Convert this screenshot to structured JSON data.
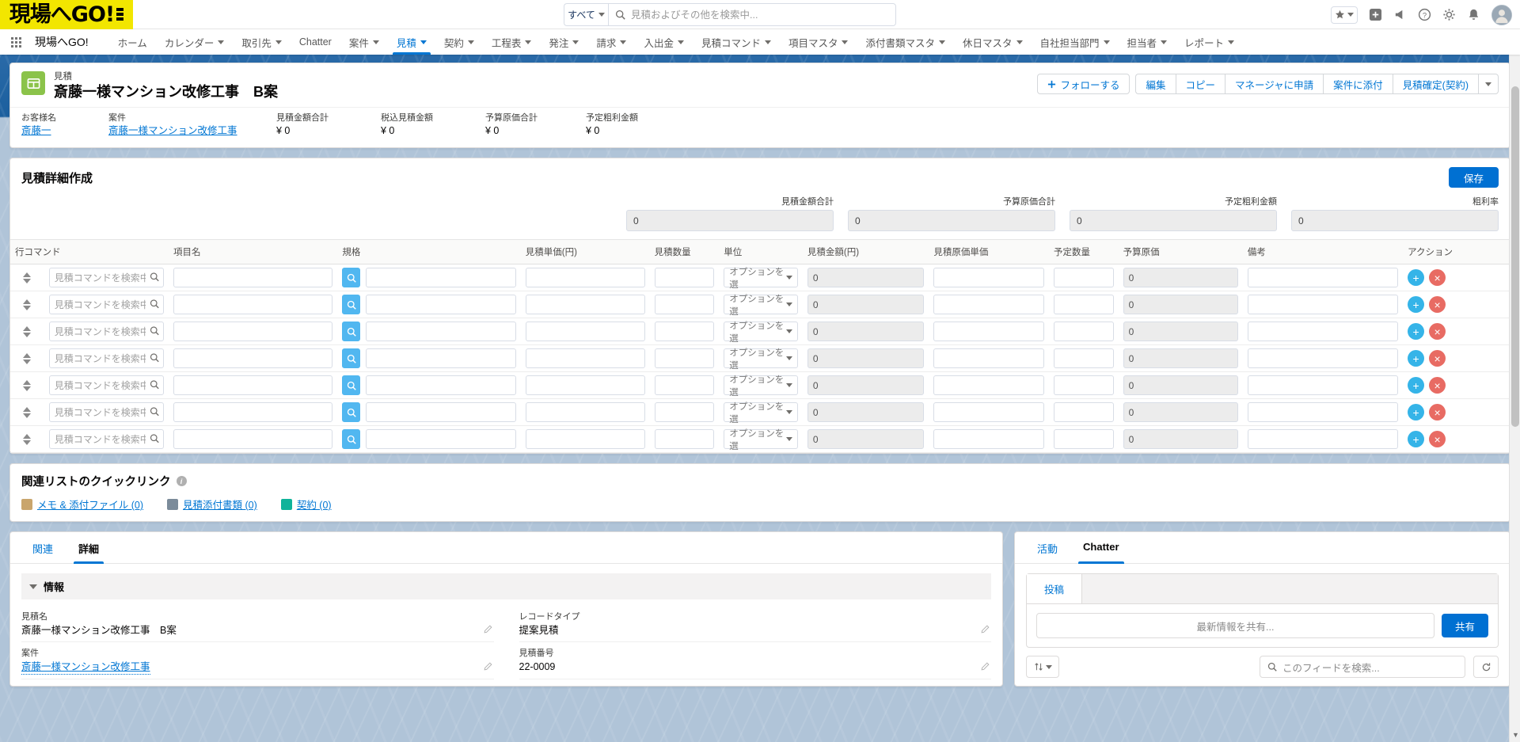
{
  "global_header": {
    "logo_text": "現場へGO!",
    "search": {
      "scope": "すべて",
      "placeholder": "見積およびその他を検索中...",
      "value": ""
    },
    "icons": [
      "star-icon",
      "add-icon",
      "megaphone-icon",
      "help-icon",
      "setup-icon",
      "notifications-icon",
      "avatar"
    ]
  },
  "app_nav": {
    "app_name": "現場へGO!",
    "items": [
      {
        "label": "ホーム",
        "has_menu": false,
        "active": false
      },
      {
        "label": "カレンダー",
        "has_menu": true,
        "active": false
      },
      {
        "label": "取引先",
        "has_menu": true,
        "active": false
      },
      {
        "label": "Chatter",
        "has_menu": false,
        "active": false
      },
      {
        "label": "案件",
        "has_menu": true,
        "active": false
      },
      {
        "label": "見積",
        "has_menu": true,
        "active": true
      },
      {
        "label": "契約",
        "has_menu": true,
        "active": false
      },
      {
        "label": "工程表",
        "has_menu": true,
        "active": false
      },
      {
        "label": "発注",
        "has_menu": true,
        "active": false
      },
      {
        "label": "請求",
        "has_menu": true,
        "active": false
      },
      {
        "label": "入出金",
        "has_menu": true,
        "active": false
      },
      {
        "label": "見積コマンド",
        "has_menu": true,
        "active": false
      },
      {
        "label": "項目マスタ",
        "has_menu": true,
        "active": false
      },
      {
        "label": "添付書類マスタ",
        "has_menu": true,
        "active": false
      },
      {
        "label": "休日マスタ",
        "has_menu": true,
        "active": false
      },
      {
        "label": "自社担当部門",
        "has_menu": true,
        "active": false
      },
      {
        "label": "担当者",
        "has_menu": true,
        "active": false
      },
      {
        "label": "レポート",
        "has_menu": true,
        "active": false
      }
    ]
  },
  "record_header": {
    "eyebrow": "見積",
    "title": "斎藤一様マンション改修工事　B案",
    "follow_button": "フォローする",
    "buttons": [
      "編集",
      "コピー",
      "マネージャに申請",
      "案件に添付",
      "見積確定(契約)"
    ],
    "fields": [
      {
        "label": "お客様名",
        "value": "斎藤一",
        "link": true
      },
      {
        "label": "案件",
        "value": "斎藤一様マンション改修工事",
        "link": true
      },
      {
        "label": "見積金額合計",
        "value": "¥ 0",
        "link": false
      },
      {
        "label": "税込見積金額",
        "value": "¥ 0",
        "link": false
      },
      {
        "label": "予算原価合計",
        "value": "¥ 0",
        "link": false
      },
      {
        "label": "予定粗利金額",
        "value": "¥ 0",
        "link": false
      }
    ]
  },
  "detail_builder": {
    "title": "見積詳細作成",
    "save_label": "保存",
    "totals": [
      {
        "label": "見積金額合計",
        "value": "0"
      },
      {
        "label": "予算原価合計",
        "value": "0"
      },
      {
        "label": "予定粗利金額",
        "value": "0"
      },
      {
        "label": "粗利率",
        "value": "0"
      }
    ],
    "columns": [
      "行コマンド",
      "項目名",
      "規格",
      "見積単価(円)",
      "見積数量",
      "単位",
      "見積金額(円)",
      "見積原価単価",
      "予定数量",
      "予算原価",
      "備考",
      "アクション"
    ],
    "row_defaults": {
      "command_placeholder": "見積コマンドを検索中",
      "item_name": "",
      "spec": "",
      "unit_price": "",
      "quantity": "",
      "unit_select": "オプションを選",
      "amount": "0",
      "cost_unit_price": "",
      "planned_quantity": "",
      "budget_cost": "0",
      "remarks": "",
      "add_label": "+",
      "delete_label": "×"
    },
    "row_count": 7
  },
  "quick_links": {
    "title": "関連リストのクイックリンク",
    "links": [
      {
        "label": "メモ & 添付ファイル (0)",
        "icon": "note-icon",
        "color": "#c9a56c"
      },
      {
        "label": "見積添付書類 (0)",
        "icon": "attachment-icon",
        "color": "#7b8b9a"
      },
      {
        "label": "契約 (0)",
        "icon": "contract-icon",
        "color": "#0fb39a"
      }
    ]
  },
  "detail_panel": {
    "tabs": [
      {
        "label": "関連",
        "active": false
      },
      {
        "label": "詳細",
        "active": true
      }
    ],
    "section_title": "情報",
    "fields_left": [
      {
        "label": "見積名",
        "value": "斎藤一様マンション改修工事　B案",
        "link": false
      },
      {
        "label": "案件",
        "value": "斎藤一様マンション改修工事",
        "link": true
      }
    ],
    "fields_right": [
      {
        "label": "レコードタイプ",
        "value": "提案見積",
        "link": false
      },
      {
        "label": "見積番号",
        "value": "22-0009",
        "link": false
      }
    ]
  },
  "chatter_panel": {
    "tabs": [
      {
        "label": "活動",
        "active": false
      },
      {
        "label": "Chatter",
        "active": true
      }
    ],
    "composer_tab": "投稿",
    "composer_placeholder": "最新情報を共有...",
    "share_label": "共有",
    "feed_search_placeholder": "このフィードを検索..."
  },
  "colors": {
    "brand_blue": "#0176d3",
    "header_yellow": "#f2e600",
    "save_blue": "#0070d2",
    "add_cyan": "#35b4e8",
    "delete_red": "#e86b63",
    "record_icon_green": "#8bc34a",
    "page_blue": "#1b5f9e"
  }
}
